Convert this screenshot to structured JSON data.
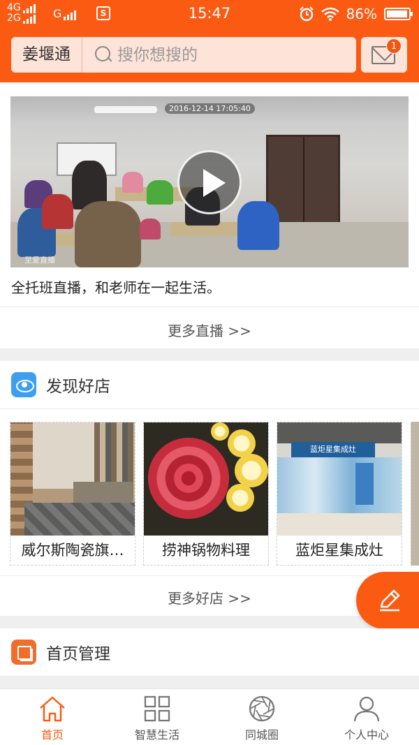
{
  "status_bar": {
    "network_1": "4G",
    "network_2": "2G",
    "network_3": "G",
    "sim_icon": "S",
    "time": "15:47",
    "battery": "86%",
    "icons": [
      "alarm-icon",
      "wifi-icon",
      "battery-icon"
    ]
  },
  "header": {
    "city": "姜堰通",
    "search_placeholder": "搜你想搜的",
    "message_badge": "1",
    "accent_color": "#fb5a12"
  },
  "live": {
    "video_timestamp": "2016-12-14 17:05:40",
    "video_watermark": "至爱直播",
    "caption": "全托班直播，和老师在一起生活。",
    "more_label": "更多直播 >>"
  },
  "shops": {
    "title": "发现好店",
    "items": [
      {
        "name": "威尔斯陶瓷旗…"
      },
      {
        "name": "捞神锅物料理"
      },
      {
        "name": "蓝炬星集成灶"
      }
    ],
    "more_label": "更多好店 >>",
    "store_sign": "蓝炬星集成灶"
  },
  "manage": {
    "title": "首页管理"
  },
  "tabbar": {
    "items": [
      {
        "label": "首页",
        "icon": "home-icon",
        "active": true
      },
      {
        "label": "智慧生活",
        "icon": "grid-icon",
        "active": false
      },
      {
        "label": "同城圈",
        "icon": "aperture-icon",
        "active": false
      },
      {
        "label": "个人中心",
        "icon": "person-icon",
        "active": false
      }
    ],
    "active_color": "#fb5a12"
  }
}
